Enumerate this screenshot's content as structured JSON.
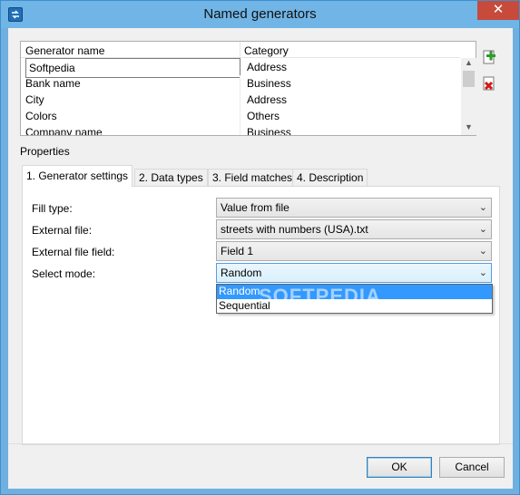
{
  "window": {
    "title": "Named generators",
    "close_glyph": "✕",
    "icon": "app-icon"
  },
  "generator_list": {
    "columns": [
      "Generator name",
      "Category"
    ],
    "rows": [
      {
        "name": "Softpedia",
        "category": "Address"
      },
      {
        "name": "Bank name",
        "category": "Business"
      },
      {
        "name": "City",
        "category": "Address"
      },
      {
        "name": "Colors",
        "category": "Others"
      },
      {
        "name": "Company name",
        "category": "Business"
      }
    ]
  },
  "side_tools": {
    "add_icon": "add-generator-icon",
    "delete_icon": "delete-generator-icon"
  },
  "properties": {
    "label": "Properties",
    "tabs": [
      {
        "label": "1. Generator settings",
        "active": true
      },
      {
        "label": "2. Data types",
        "active": false
      },
      {
        "label": "3. Field matches",
        "active": false
      },
      {
        "label": "4. Description",
        "active": false
      }
    ],
    "fields": [
      {
        "label": "Fill type:",
        "value": "Value from file"
      },
      {
        "label": "External file:",
        "value": "streets with numbers (USA).txt"
      },
      {
        "label": "External file field:",
        "value": "Field 1"
      },
      {
        "label": "Select mode:",
        "value": "Random"
      }
    ],
    "select_mode_options": [
      "Random",
      "Sequential"
    ],
    "select_mode_highlighted": "Random"
  },
  "watermark": "SOFTPEDIA",
  "buttons": {
    "ok": "OK",
    "cancel": "Cancel"
  },
  "colors": {
    "titlebar": "#71b4e6",
    "close": "#c74a3b",
    "highlight": "#3399ff"
  }
}
